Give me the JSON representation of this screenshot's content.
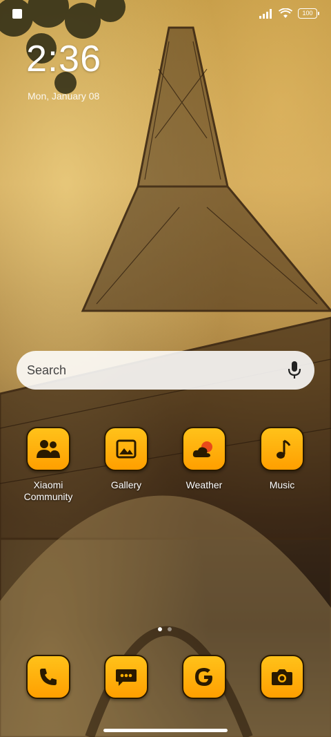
{
  "status_bar": {
    "battery": "100"
  },
  "lockclock": {
    "time": "2:36",
    "date": "Mon, January 08"
  },
  "search": {
    "placeholder": "Search"
  },
  "apps": [
    {
      "label": "Xiaomi Community",
      "icon": "people-icon"
    },
    {
      "label": "Gallery",
      "icon": "picture-icon"
    },
    {
      "label": "Weather",
      "icon": "weather-icon"
    },
    {
      "label": "Music",
      "icon": "music-note-icon"
    }
  ],
  "dock": [
    {
      "icon": "phone-icon"
    },
    {
      "icon": "message-icon"
    },
    {
      "icon": "google-icon"
    },
    {
      "icon": "camera-icon"
    }
  ],
  "page_indicator": {
    "pages": 2,
    "current": 1
  },
  "colors": {
    "icon_bg": "#ffb000",
    "icon_border": "#2a1a00"
  }
}
